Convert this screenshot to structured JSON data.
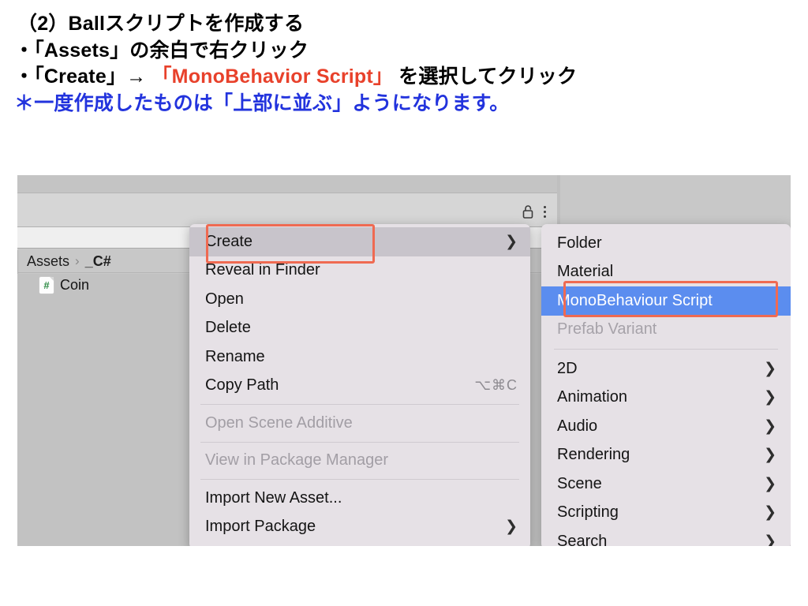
{
  "slide": {
    "line1": "（2）Ballスクリプトを作成する",
    "line2": "・「Assets」の余白で右クリック",
    "line3_a": "・「Create」→ ",
    "line3_b": "「MonoBehavior Script」",
    "line3_c": " を選択してクリック",
    "line4": "＊一度作成したものは「上部に並ぶ」ようになります。",
    "accent_red": "#e8412b",
    "accent_blue": "#2233dd",
    "highlight_box_color": "#ef6a52",
    "menu_highlight_blue": "#5b8def"
  },
  "project_panel": {
    "lock_icon": "unlocked-padlock-icon",
    "kebab_icon": "more-options-icon",
    "breadcrumb": {
      "root": "Assets",
      "separator": "›",
      "current": "_C#"
    },
    "assets": [
      {
        "icon": "csharp-script-icon",
        "icon_glyph": "#",
        "label": "Coin"
      }
    ]
  },
  "context_menu": {
    "items": [
      {
        "label": "Create",
        "submenu": true,
        "chevron": "❯",
        "selected": true,
        "disabled": false,
        "shortcut": ""
      },
      {
        "label": "Reveal in Finder",
        "submenu": false,
        "chevron": "",
        "selected": false,
        "disabled": false,
        "shortcut": ""
      },
      {
        "label": "Open",
        "submenu": false,
        "chevron": "",
        "selected": false,
        "disabled": false,
        "shortcut": ""
      },
      {
        "label": "Delete",
        "submenu": false,
        "chevron": "",
        "selected": false,
        "disabled": false,
        "shortcut": ""
      },
      {
        "label": "Rename",
        "submenu": false,
        "chevron": "",
        "selected": false,
        "disabled": false,
        "shortcut": ""
      },
      {
        "label": "Copy Path",
        "submenu": false,
        "chevron": "",
        "selected": false,
        "disabled": false,
        "shortcut": "⌥⌘C"
      },
      {
        "separator": true
      },
      {
        "label": "Open Scene Additive",
        "submenu": false,
        "chevron": "",
        "selected": false,
        "disabled": true,
        "shortcut": ""
      },
      {
        "separator": true
      },
      {
        "label": "View in Package Manager",
        "submenu": false,
        "chevron": "",
        "selected": false,
        "disabled": true,
        "shortcut": ""
      },
      {
        "separator": true
      },
      {
        "label": "Import New Asset...",
        "submenu": false,
        "chevron": "",
        "selected": false,
        "disabled": false,
        "shortcut": ""
      },
      {
        "label": "Import Package",
        "submenu": true,
        "chevron": "❯",
        "selected": false,
        "disabled": false,
        "shortcut": ""
      }
    ]
  },
  "create_submenu": {
    "items": [
      {
        "label": "Folder",
        "submenu": false,
        "chevron": "",
        "highlighted": false,
        "disabled": false
      },
      {
        "label": "Material",
        "submenu": false,
        "chevron": "",
        "highlighted": false,
        "disabled": false
      },
      {
        "label": "MonoBehaviour Script",
        "submenu": false,
        "chevron": "",
        "highlighted": true,
        "disabled": false
      },
      {
        "label": "Prefab Variant",
        "submenu": false,
        "chevron": "",
        "highlighted": false,
        "disabled": true
      },
      {
        "separator": true
      },
      {
        "label": "2D",
        "submenu": true,
        "chevron": "❯",
        "highlighted": false,
        "disabled": false
      },
      {
        "label": "Animation",
        "submenu": true,
        "chevron": "❯",
        "highlighted": false,
        "disabled": false
      },
      {
        "label": "Audio",
        "submenu": true,
        "chevron": "❯",
        "highlighted": false,
        "disabled": false
      },
      {
        "label": "Rendering",
        "submenu": true,
        "chevron": "❯",
        "highlighted": false,
        "disabled": false
      },
      {
        "label": "Scene",
        "submenu": true,
        "chevron": "❯",
        "highlighted": false,
        "disabled": false
      },
      {
        "label": "Scripting",
        "submenu": true,
        "chevron": "❯",
        "highlighted": false,
        "disabled": false
      },
      {
        "label": "Search",
        "submenu": true,
        "chevron": "❯",
        "highlighted": false,
        "disabled": false
      }
    ]
  }
}
